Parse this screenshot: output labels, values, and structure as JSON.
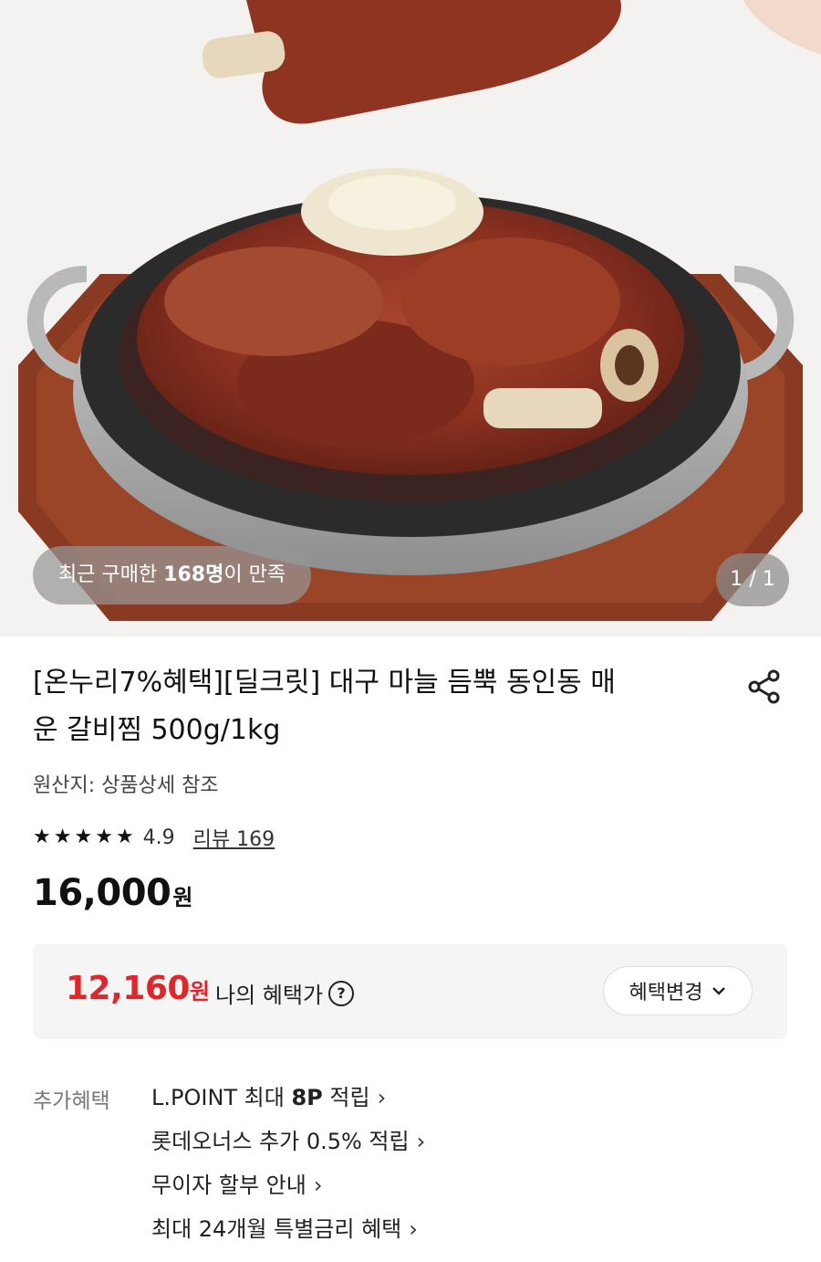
{
  "hero": {
    "satisfaction": {
      "prefix": "최근 구매한 ",
      "count": "168명",
      "suffix": "이 만족"
    },
    "pager": "1 / 1"
  },
  "product": {
    "title_line1": "[온누리7%혜택][딜크릿] 대구 마늘 듬뿍 동인동 매",
    "title_line2": "운 갈비찜 500g/1kg",
    "origin": "원산지: 상품상세 참조",
    "rating": {
      "stars": 5,
      "score": "4.9",
      "review_link": "리뷰 169"
    },
    "price": {
      "amount": "16,000",
      "unit": "원"
    }
  },
  "benefit": {
    "amount": "12,160",
    "unit": "원",
    "label": "나의 혜택가",
    "help": "?",
    "change_button": "혜택변경"
  },
  "extra": {
    "label": "추가혜택",
    "items": [
      {
        "pre": "L.POINT 최대 ",
        "bold": "8P",
        "post": " 적립"
      },
      {
        "pre": "롯데오너스 추가 0.5% 적립",
        "bold": "",
        "post": ""
      },
      {
        "pre": "무이자 할부 안내",
        "bold": "",
        "post": ""
      },
      {
        "pre": "최대 24개월 특별금리 혜택",
        "bold": "",
        "post": ""
      }
    ]
  },
  "colors": {
    "accent_red": "#e0262a",
    "box_bg": "#f5f5f5"
  },
  "icons": {
    "share": "share-icon",
    "chevron": "chevron-right-icon",
    "dropdown": "chevron-down-icon",
    "star": "star-icon"
  }
}
